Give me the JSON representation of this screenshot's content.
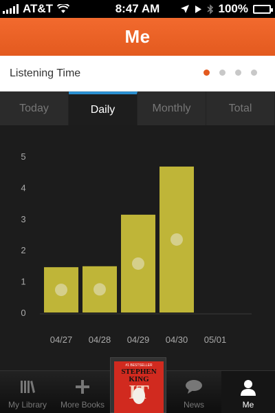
{
  "status_bar": {
    "carrier": "AT&T",
    "time": "8:47 AM",
    "battery": "100%"
  },
  "nav": {
    "title": "Me"
  },
  "subheader": {
    "title": "Listening Time",
    "page_count": 4,
    "active_page": 0
  },
  "tabs": [
    {
      "label": "Today",
      "active": false
    },
    {
      "label": "Daily",
      "active": true
    },
    {
      "label": "Monthly",
      "active": false
    },
    {
      "label": "Total",
      "active": false
    }
  ],
  "chart_data": {
    "type": "bar",
    "categories": [
      "04/27",
      "04/28",
      "04/29",
      "04/30",
      "05/01"
    ],
    "values": [
      1.45,
      1.48,
      3.13,
      4.67,
      0
    ],
    "ylim": [
      0,
      5
    ],
    "yticks": [
      "0",
      "1",
      "2",
      "3",
      "4",
      "5"
    ],
    "bar_color": "#bfb538",
    "marker_color": "#d8d49a"
  },
  "now_playing": {
    "cover_top": "#1 BESTSELLER",
    "cover_author": "STEPHEN KING",
    "cover_title": "IT"
  },
  "tabbar": [
    {
      "label": "My Library",
      "icon": "library-icon",
      "active": false
    },
    {
      "label": "More Books",
      "icon": "plus-icon",
      "active": false
    },
    {
      "label": "News",
      "icon": "speech-bubble-icon",
      "active": false
    },
    {
      "label": "Me",
      "icon": "person-icon",
      "active": true
    }
  ]
}
